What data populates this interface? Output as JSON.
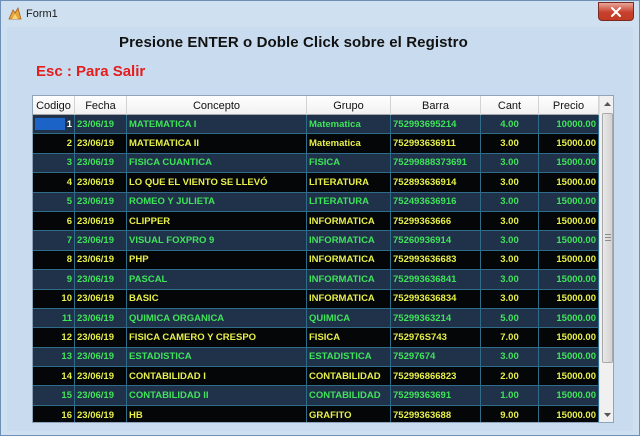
{
  "window": {
    "title": "Form1",
    "close_glyph": "close-icon"
  },
  "header": {
    "instruction": "Presione ENTER  o Doble Click sobre el Registro",
    "exit_hint": "Esc : Para Salir"
  },
  "colors": {
    "window_bg": "#c9dcef",
    "row_dark": "#050608",
    "row_blue": "#1f3249",
    "text_green": "#3fe35a",
    "text_yellow": "#e7f04a",
    "exit_red": "#e41d1d",
    "selection": "#1b63c7"
  },
  "table": {
    "columns": [
      "Codigo",
      "Fecha",
      "Concepto",
      "Grupo",
      "Barra",
      "Cant",
      "Precio"
    ],
    "rows": [
      [
        "1",
        "23/06/19",
        "MATEMATICA I",
        "Matematica",
        "752993695214",
        "4.00",
        "10000.00"
      ],
      [
        "2",
        "23/06/19",
        "MATEMATICA II",
        "Matematica",
        "752993636911",
        "3.00",
        "15000.00"
      ],
      [
        "3",
        "23/06/19",
        "FISICA CUANTICA",
        "FISICA",
        "75299888373691",
        "3.00",
        "15000.00"
      ],
      [
        "4",
        "23/06/19",
        "LO QUE EL VIENTO SE LLEVÓ",
        "LITERATURA",
        "752893636914",
        "3.00",
        "15000.00"
      ],
      [
        "5",
        "23/06/19",
        "ROMEO Y JULIETA",
        "LITERATURA",
        "752493636916",
        "3.00",
        "15000.00"
      ],
      [
        "6",
        "23/06/19",
        "CLIPPER",
        "INFORMATICA",
        "75299363666",
        "3.00",
        "15000.00"
      ],
      [
        "7",
        "23/06/19",
        "VISUAL FOXPRO 9",
        "INFORMATICA",
        "75260936914",
        "3.00",
        "15000.00"
      ],
      [
        "8",
        "23/06/19",
        "PHP",
        "INFORMATICA",
        "752993636683",
        "3.00",
        "15000.00"
      ],
      [
        "9",
        "23/06/19",
        "PASCAL",
        "INFORMATICA",
        "752993636841",
        "3.00",
        "15000.00"
      ],
      [
        "10",
        "23/06/19",
        "BASIC",
        "INFORMATICA",
        "752993636834",
        "3.00",
        "15000.00"
      ],
      [
        "11",
        "23/06/19",
        "QUIMICA ORGANICA",
        "QUIMICA",
        "75299363214",
        "5.00",
        "15000.00"
      ],
      [
        "12",
        "23/06/19",
        "FISICA CAMERO Y CRESPO",
        "FISICA",
        "752976S743",
        "7.00",
        "15000.00"
      ],
      [
        "13",
        "23/06/19",
        "ESTADISTICA",
        "ESTADISTICA",
        "75297674",
        "3.00",
        "15000.00"
      ],
      [
        "14",
        "23/06/19",
        "CONTABILIDAD I",
        "CONTABILIDAD",
        "752996866823",
        "2.00",
        "15000.00"
      ],
      [
        "15",
        "23/06/19",
        "CONTABILIDAD II",
        "CONTABILIDAD",
        "75299363691",
        "1.00",
        "15000.00"
      ],
      [
        "16",
        "23/06/19",
        "HB",
        "GRAFITO",
        "75299363688",
        "9.00",
        "15000.00"
      ]
    ]
  },
  "scrollbar": {
    "up_icon": "chevron-up-icon",
    "down_icon": "chevron-down-icon"
  }
}
